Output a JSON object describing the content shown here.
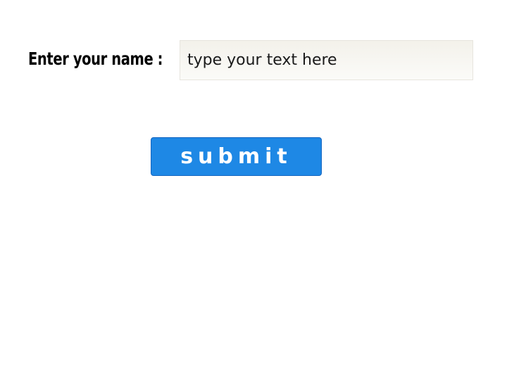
{
  "form": {
    "name_label": "Enter your name :",
    "name_input": {
      "value": "",
      "placeholder": "type your text here"
    },
    "submit_label": "submit"
  },
  "colors": {
    "button_bg": "#1e88e5",
    "button_border": "#1565c0",
    "button_text": "#ffffff",
    "input_bg": "#f5f4ef",
    "label_text": "#000000"
  }
}
